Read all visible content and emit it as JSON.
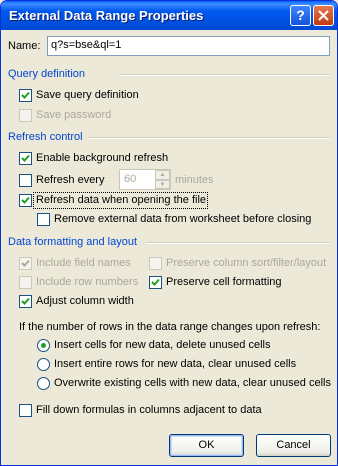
{
  "window": {
    "title": "External Data Range Properties"
  },
  "name_field": {
    "label": "Name:",
    "value": "q?s=bse&ql=1"
  },
  "query_definition": {
    "title": "Query definition",
    "save_query": {
      "label": "Save query definition",
      "checked": true
    },
    "save_password": {
      "label": "Save password",
      "checked": false,
      "disabled": true
    }
  },
  "refresh_control": {
    "title": "Refresh control",
    "background_refresh": {
      "label": "Enable background refresh",
      "checked": true
    },
    "refresh_every": {
      "label": "Refresh every",
      "checked": false,
      "value": "60",
      "unit": "minutes"
    },
    "refresh_on_open": {
      "label": "Refresh data when opening the file",
      "checked": true
    },
    "remove_external": {
      "label": "Remove external data from worksheet before closing",
      "checked": false
    }
  },
  "formatting": {
    "title": "Data formatting and layout",
    "include_field_names": {
      "label": "Include field names",
      "checked": true,
      "disabled": true
    },
    "include_row_numbers": {
      "label": "Include row numbers",
      "checked": false,
      "disabled": true
    },
    "adjust_column_width": {
      "label": "Adjust column width",
      "checked": true
    },
    "preserve_sort": {
      "label": "Preserve column sort/filter/layout",
      "checked": true,
      "disabled": true
    },
    "preserve_cell_formatting": {
      "label": "Preserve cell formatting",
      "checked": true
    }
  },
  "rows_change": {
    "prompt": "If the number of rows in the data range changes upon refresh:",
    "options": [
      {
        "label": "Insert cells for new data, delete unused cells",
        "selected": true
      },
      {
        "label": "Insert entire rows for new data, clear unused cells",
        "selected": false
      },
      {
        "label": "Overwrite existing cells with new data, clear unused cells",
        "selected": false
      }
    ]
  },
  "fill_down": {
    "label": "Fill down formulas in columns adjacent to data",
    "checked": false
  },
  "buttons": {
    "ok": "OK",
    "cancel": "Cancel"
  },
  "colors": {
    "titlebar": "#0058EE",
    "group_title": "#0046D5",
    "dialog_bg": "#ECE9D8"
  }
}
